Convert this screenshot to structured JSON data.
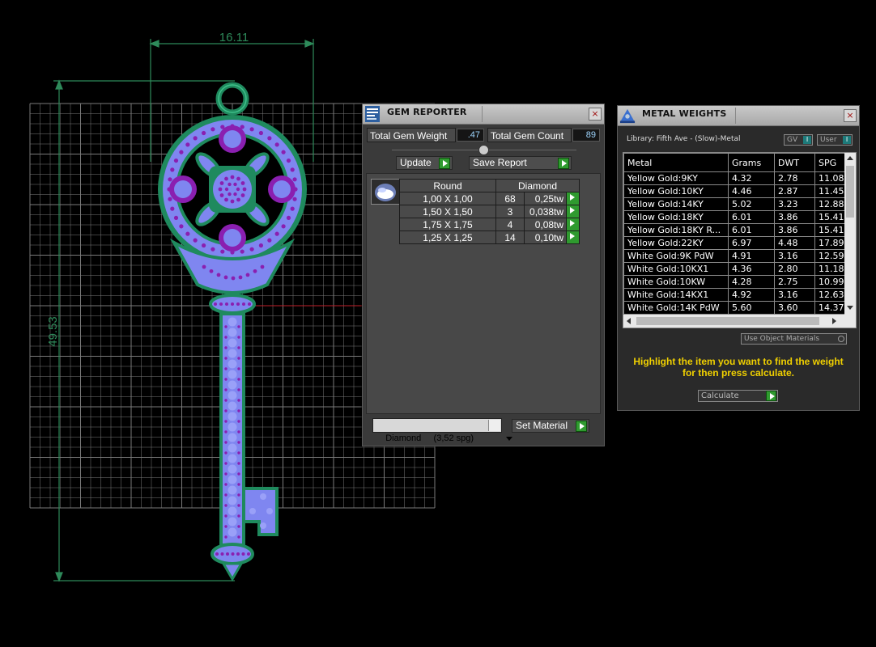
{
  "cad": {
    "dim_width": "16.11",
    "dim_height": "49.53",
    "colors": {
      "grid": "#7a7a7a",
      "metal": "#1f8a5e",
      "metal_light": "#2db07a",
      "stone": "#7f86f0",
      "center_stone": "#8a1fb0",
      "dim_line": "#2e8a5a"
    }
  },
  "gem_reporter": {
    "title": "GEM REPORTER",
    "close": "×",
    "total_weight_label": "Total Gem Weight",
    "total_weight_value": ".47",
    "total_count_label": "Total Gem Count",
    "total_count_value": "89",
    "update_label": "Update",
    "save_report_label": "Save Report",
    "table_header": {
      "shape": "Round",
      "material": "Diamond"
    },
    "rows": [
      {
        "size": "1,00 X 1,00",
        "count": "68",
        "weight": "0,25tw"
      },
      {
        "size": "1,50 X 1,50",
        "count": "3",
        "weight": "0,038tw"
      },
      {
        "size": "1,75 X 1,75",
        "count": "4",
        "weight": "0,08tw"
      },
      {
        "size": "1,25 X 1,25",
        "count": "14",
        "weight": "0,10tw"
      }
    ],
    "material_select": "Diamond     (3,52 spg)",
    "set_material_label": "Set Material"
  },
  "metal_weights": {
    "title": "METAL WEIGHTS",
    "close": "×",
    "library": "Library: Fifth Ave - (Slow)-Metal",
    "gv_label": "GV",
    "user_label": "User",
    "columns": [
      "Metal",
      "Grams",
      "DWT",
      "SPG"
    ],
    "rows": [
      [
        "Yellow Gold:9KY",
        "4.32",
        "2.78",
        "11.08"
      ],
      [
        "Yellow Gold:10KY",
        "4.46",
        "2.87",
        "11.45"
      ],
      [
        "Yellow Gold:14KY",
        "5.02",
        "3.23",
        "12.88"
      ],
      [
        "Yellow Gold:18KY",
        "6.01",
        "3.86",
        "15.41"
      ],
      [
        "Yellow Gold:18KY R...",
        "6.01",
        "3.86",
        "15.41"
      ],
      [
        "Yellow Gold:22KY",
        "6.97",
        "4.48",
        "17.89"
      ],
      [
        "White Gold:9K PdW",
        "4.91",
        "3.16",
        "12.59"
      ],
      [
        "White Gold:10KX1",
        "4.36",
        "2.80",
        "11.18"
      ],
      [
        "White Gold:10KW",
        "4.28",
        "2.75",
        "10.99"
      ],
      [
        "White Gold:14KX1",
        "4.92",
        "3.16",
        "12.63"
      ],
      [
        "White Gold:14K PdW",
        "5.60",
        "3.60",
        "14.37"
      ]
    ],
    "use_object_materials": "Use Object Materials",
    "instruction": "Highlight the item you want to find the weight for then press calculate.",
    "calculate_label": "Calculate"
  }
}
